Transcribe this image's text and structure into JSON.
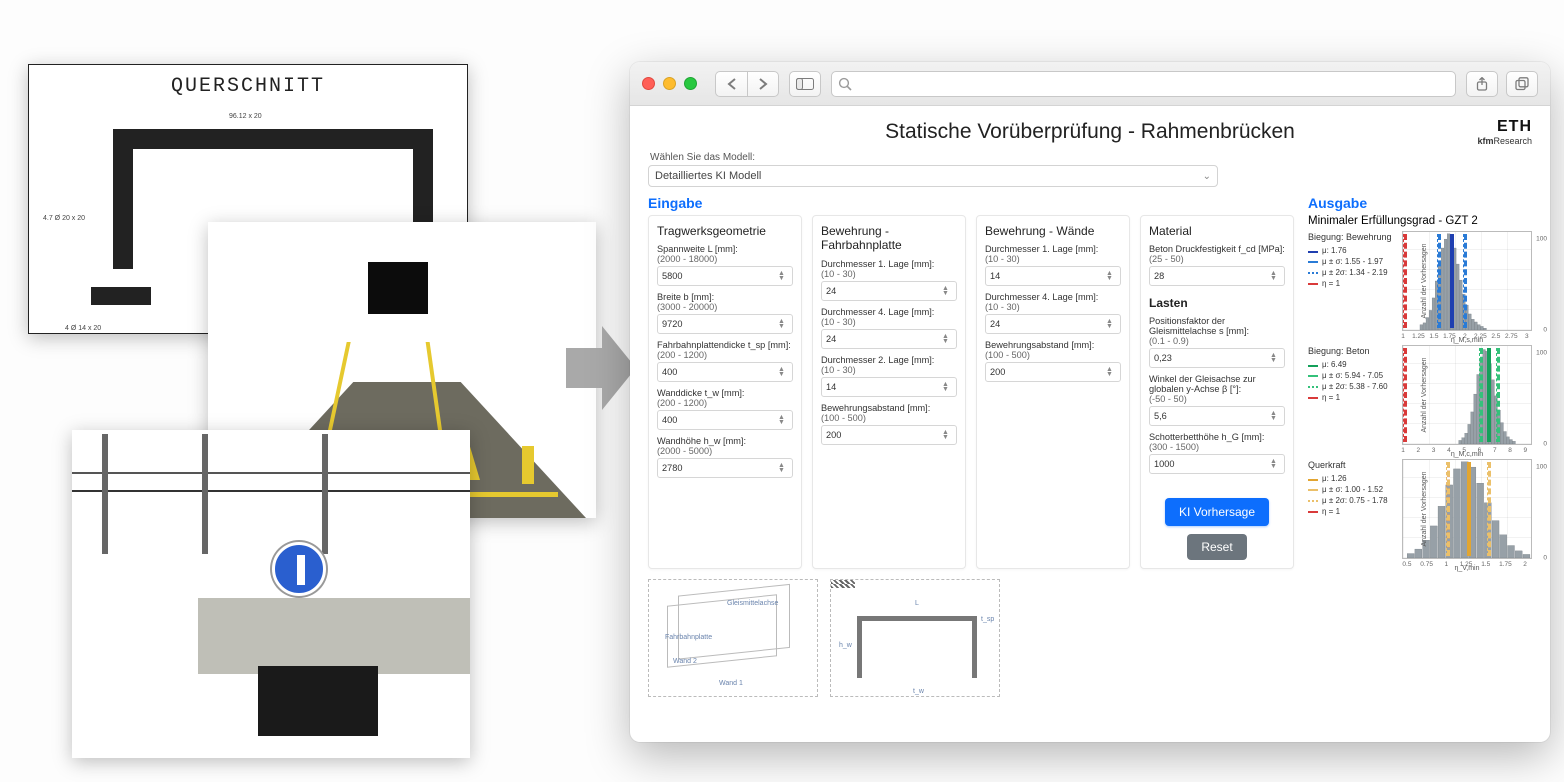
{
  "left_images": {
    "drawing_title": "QUERSCHNITT"
  },
  "toolbar": {
    "search_placeholder": ""
  },
  "app": {
    "title": "Statische Vorüberprüfung - Rahmenbrücken",
    "brand_top": "ETH",
    "brand_sub_prefix": "kfm",
    "brand_sub_suffix": "Research",
    "model_label": "Wählen Sie das Modell:",
    "model_value": "Detailliertes KI Modell",
    "eingabe_label": "Eingabe",
    "ausgabe_label": "Ausgabe"
  },
  "panels": {
    "geometrie": {
      "heading": "Tragwerksgeometrie",
      "span_label": "Spannweite L [mm]:",
      "span_range": "(2000 - 18000)",
      "span_value": "5800",
      "breite_label": "Breite b [mm]:",
      "breite_range": "(3000 - 20000)",
      "breite_value": "9720",
      "platte_label": "Fahrbahnplattendicke t_sp [mm]:",
      "platte_range": "(200 - 1200)",
      "platte_value": "400",
      "wanddicke_label": "Wanddicke t_w [mm]:",
      "wanddicke_range": "(200 - 1200)",
      "wanddicke_value": "400",
      "wandhoehe_label": "Wandhöhe h_w [mm]:",
      "wandhoehe_range": "(2000 - 5000)",
      "wandhoehe_value": "2780"
    },
    "bewehrung_platte": {
      "heading": "Bewehrung - Fahrbahnplatte",
      "d1_label": "Durchmesser 1. Lage [mm]:",
      "d1_range": "(10 - 30)",
      "d1_value": "24",
      "d4_label": "Durchmesser 4. Lage [mm]:",
      "d4_range": "(10 - 30)",
      "d4_value": "24",
      "d2_label": "Durchmesser 2. Lage [mm]:",
      "d2_range": "(10 - 30)",
      "d2_value": "14",
      "abst_label": "Bewehrungsabstand [mm]:",
      "abst_range": "(100 - 500)",
      "abst_value": "200"
    },
    "bewehrung_waende": {
      "heading": "Bewehrung - Wände",
      "d1_label": "Durchmesser 1. Lage [mm]:",
      "d1_range": "(10 - 30)",
      "d1_value": "14",
      "d4_label": "Durchmesser 4. Lage [mm]:",
      "d4_range": "(10 - 30)",
      "d4_value": "24",
      "abst_label": "Bewehrungsabstand [mm]:",
      "abst_range": "(100 - 500)",
      "abst_value": "200"
    },
    "material": {
      "heading": "Material",
      "fcd_label": "Beton Druckfestigkeit f_cd [MPa]:",
      "fcd_range": "(25 - 50)",
      "fcd_value": "28",
      "lasten_heading": "Lasten",
      "pos_label": "Positionsfaktor der Gleismittelachse s [mm]:",
      "pos_range": "(0.1 - 0.9)",
      "pos_value": "0,23",
      "winkel_label": "Winkel der Gleisachse zur globalen y-Achse β [°]:",
      "winkel_range": "(-50 - 50)",
      "winkel_value": "5,6",
      "hg_label": "Schotterbetthöhe h_G [mm]:",
      "hg_range": "(300 - 1500)",
      "hg_value": "1000"
    }
  },
  "actions": {
    "predict": "KI Vorhersage",
    "reset": "Reset"
  },
  "diagram_labels": {
    "gleis": "Gleismittelachse",
    "platte": "Fahrbahnplatte",
    "wand1": "Wand 1",
    "wand2": "Wand 2",
    "L": "L",
    "hw": "h_w",
    "tw": "t_w",
    "tsp": "t_sp"
  },
  "output": {
    "title": "Minimaler Erfüllungsgrad - GZT 2",
    "ylabel": "Anzahl der Vorhersagen",
    "blocks": [
      {
        "title": "Biegung: Bewehrung",
        "mu": "μ: 1.76",
        "sig1": "μ ± σ: 1.55 - 1.97",
        "sig2": "μ ± 2σ: 1.34 - 2.19",
        "eta": "η = 1",
        "xlabel": "η_M,s,min",
        "colors": {
          "mu": "#1f3fb0",
          "sig": "#2a7bd6",
          "eta": "#d93a3a"
        }
      },
      {
        "title": "Biegung: Beton",
        "mu": "μ: 6.49",
        "sig1": "μ ± σ: 5.94 - 7.05",
        "sig2": "μ ± 2σ: 5.38 - 7.60",
        "eta": "η = 1",
        "xlabel": "η_M,c,min",
        "colors": {
          "mu": "#14a05a",
          "sig": "#34c17a",
          "eta": "#d93a3a"
        }
      },
      {
        "title": "Querkraft",
        "mu": "μ: 1.26",
        "sig1": "μ ± σ: 1.00 - 1.52",
        "sig2": "μ ± 2σ: 0.75 - 1.78",
        "eta": "η = 1",
        "xlabel": "η_V,min",
        "colors": {
          "mu": "#e2a531",
          "sig": "#ebc06a",
          "eta": "#d93a3a"
        }
      }
    ]
  },
  "chart_data": [
    {
      "type": "bar",
      "title": "Biegung: Bewehrung",
      "xlabel": "η_M,s,min",
      "ylabel": "Anzahl der Vorhersagen",
      "series_name": "Histogramm",
      "x_ticks": [
        1.0,
        1.25,
        1.5,
        1.75,
        2.0,
        2.25,
        2.5,
        2.75,
        3.0
      ],
      "y_ticks": [
        0,
        100
      ],
      "ylim": [
        0,
        110
      ],
      "xlim": [
        1.0,
        3.1
      ],
      "categories": [
        1.3,
        1.35,
        1.4,
        1.45,
        1.5,
        1.55,
        1.6,
        1.65,
        1.7,
        1.75,
        1.8,
        1.85,
        1.9,
        1.95,
        2.0,
        2.05,
        2.1,
        2.15,
        2.2,
        2.25,
        2.3,
        2.35
      ],
      "values": [
        6,
        8,
        14,
        22,
        36,
        55,
        76,
        92,
        102,
        108,
        104,
        92,
        74,
        56,
        40,
        28,
        18,
        12,
        9,
        6,
        4,
        2
      ],
      "reference_lines": {
        "mu": 1.76,
        "mu_minus_sigma": 1.55,
        "mu_plus_sigma": 1.97,
        "eta": 1.0
      }
    },
    {
      "type": "bar",
      "title": "Biegung: Beton",
      "xlabel": "η_M,c,min",
      "ylabel": "Anzahl der Vorhersagen",
      "series_name": "Histogramm",
      "x_ticks": [
        1,
        2,
        3,
        4,
        5,
        6,
        7,
        8,
        9
      ],
      "y_ticks": [
        0,
        100
      ],
      "ylim": [
        0,
        110
      ],
      "xlim": [
        1,
        9.5
      ],
      "categories": [
        4.8,
        5.0,
        5.2,
        5.4,
        5.6,
        5.8,
        6.0,
        6.2,
        6.4,
        6.6,
        6.8,
        7.0,
        7.2,
        7.4,
        7.6,
        7.8,
        8.0,
        8.2,
        8.4
      ],
      "values": [
        4,
        7,
        12,
        22,
        36,
        56,
        78,
        96,
        106,
        104,
        90,
        72,
        54,
        38,
        24,
        14,
        8,
        5,
        3
      ],
      "reference_lines": {
        "mu": 6.49,
        "mu_minus_sigma": 5.94,
        "mu_plus_sigma": 7.05,
        "eta": 1.0
      }
    },
    {
      "type": "bar",
      "title": "Querkraft",
      "xlabel": "η_V,min",
      "ylabel": "Anzahl der Vorhersagen",
      "series_name": "Histogramm",
      "x_ticks": [
        0.5,
        0.75,
        1.0,
        1.25,
        1.5,
        1.75,
        2.0
      ],
      "y_ticks": [
        0,
        100
      ],
      "ylim": [
        0,
        110
      ],
      "xlim": [
        0.45,
        2.1
      ],
      "categories": [
        0.55,
        0.65,
        0.75,
        0.85,
        0.95,
        1.05,
        1.15,
        1.25,
        1.35,
        1.45,
        1.55,
        1.65,
        1.75,
        1.85,
        1.95,
        2.05
      ],
      "values": [
        5,
        10,
        20,
        36,
        58,
        82,
        100,
        108,
        102,
        84,
        62,
        42,
        26,
        14,
        8,
        4
      ],
      "reference_lines": {
        "mu": 1.26,
        "mu_minus_sigma": 1.0,
        "mu_plus_sigma": 1.52,
        "eta": 1.0
      }
    }
  ]
}
